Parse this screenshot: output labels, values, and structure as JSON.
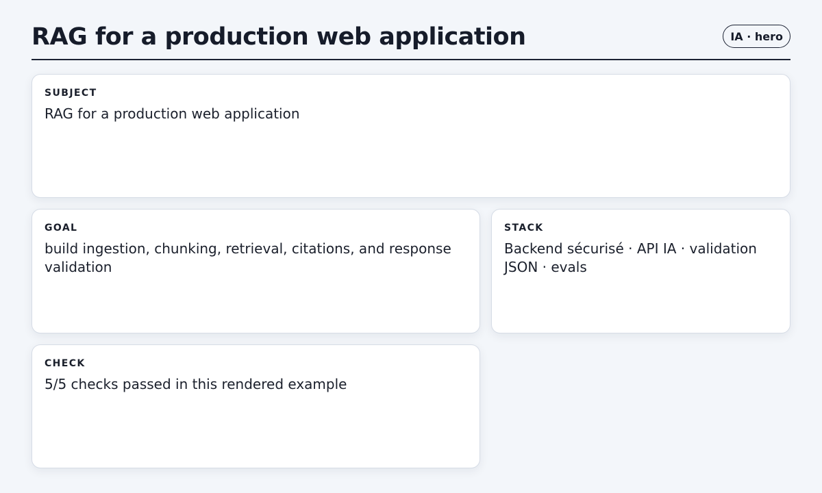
{
  "header": {
    "title": "RAG for a production web application",
    "badge": "IA · hero"
  },
  "cards": {
    "subject": {
      "label": "SUBJECT",
      "value": "RAG for a production web application"
    },
    "goal": {
      "label": "GOAL",
      "value": "build ingestion, chunking, retrieval, citations, and response validation"
    },
    "stack": {
      "label": "STACK",
      "value": "Backend sécurisé · API IA · validation JSON · evals"
    },
    "check": {
      "label": "CHECK",
      "value": "5/5 checks passed in this rendered example"
    }
  },
  "colors": {
    "background": "#f3f6fa",
    "text": "#1a1f2b",
    "card": "#ffffff",
    "card_border": "#d6dce6",
    "rule": "#1b2233"
  }
}
